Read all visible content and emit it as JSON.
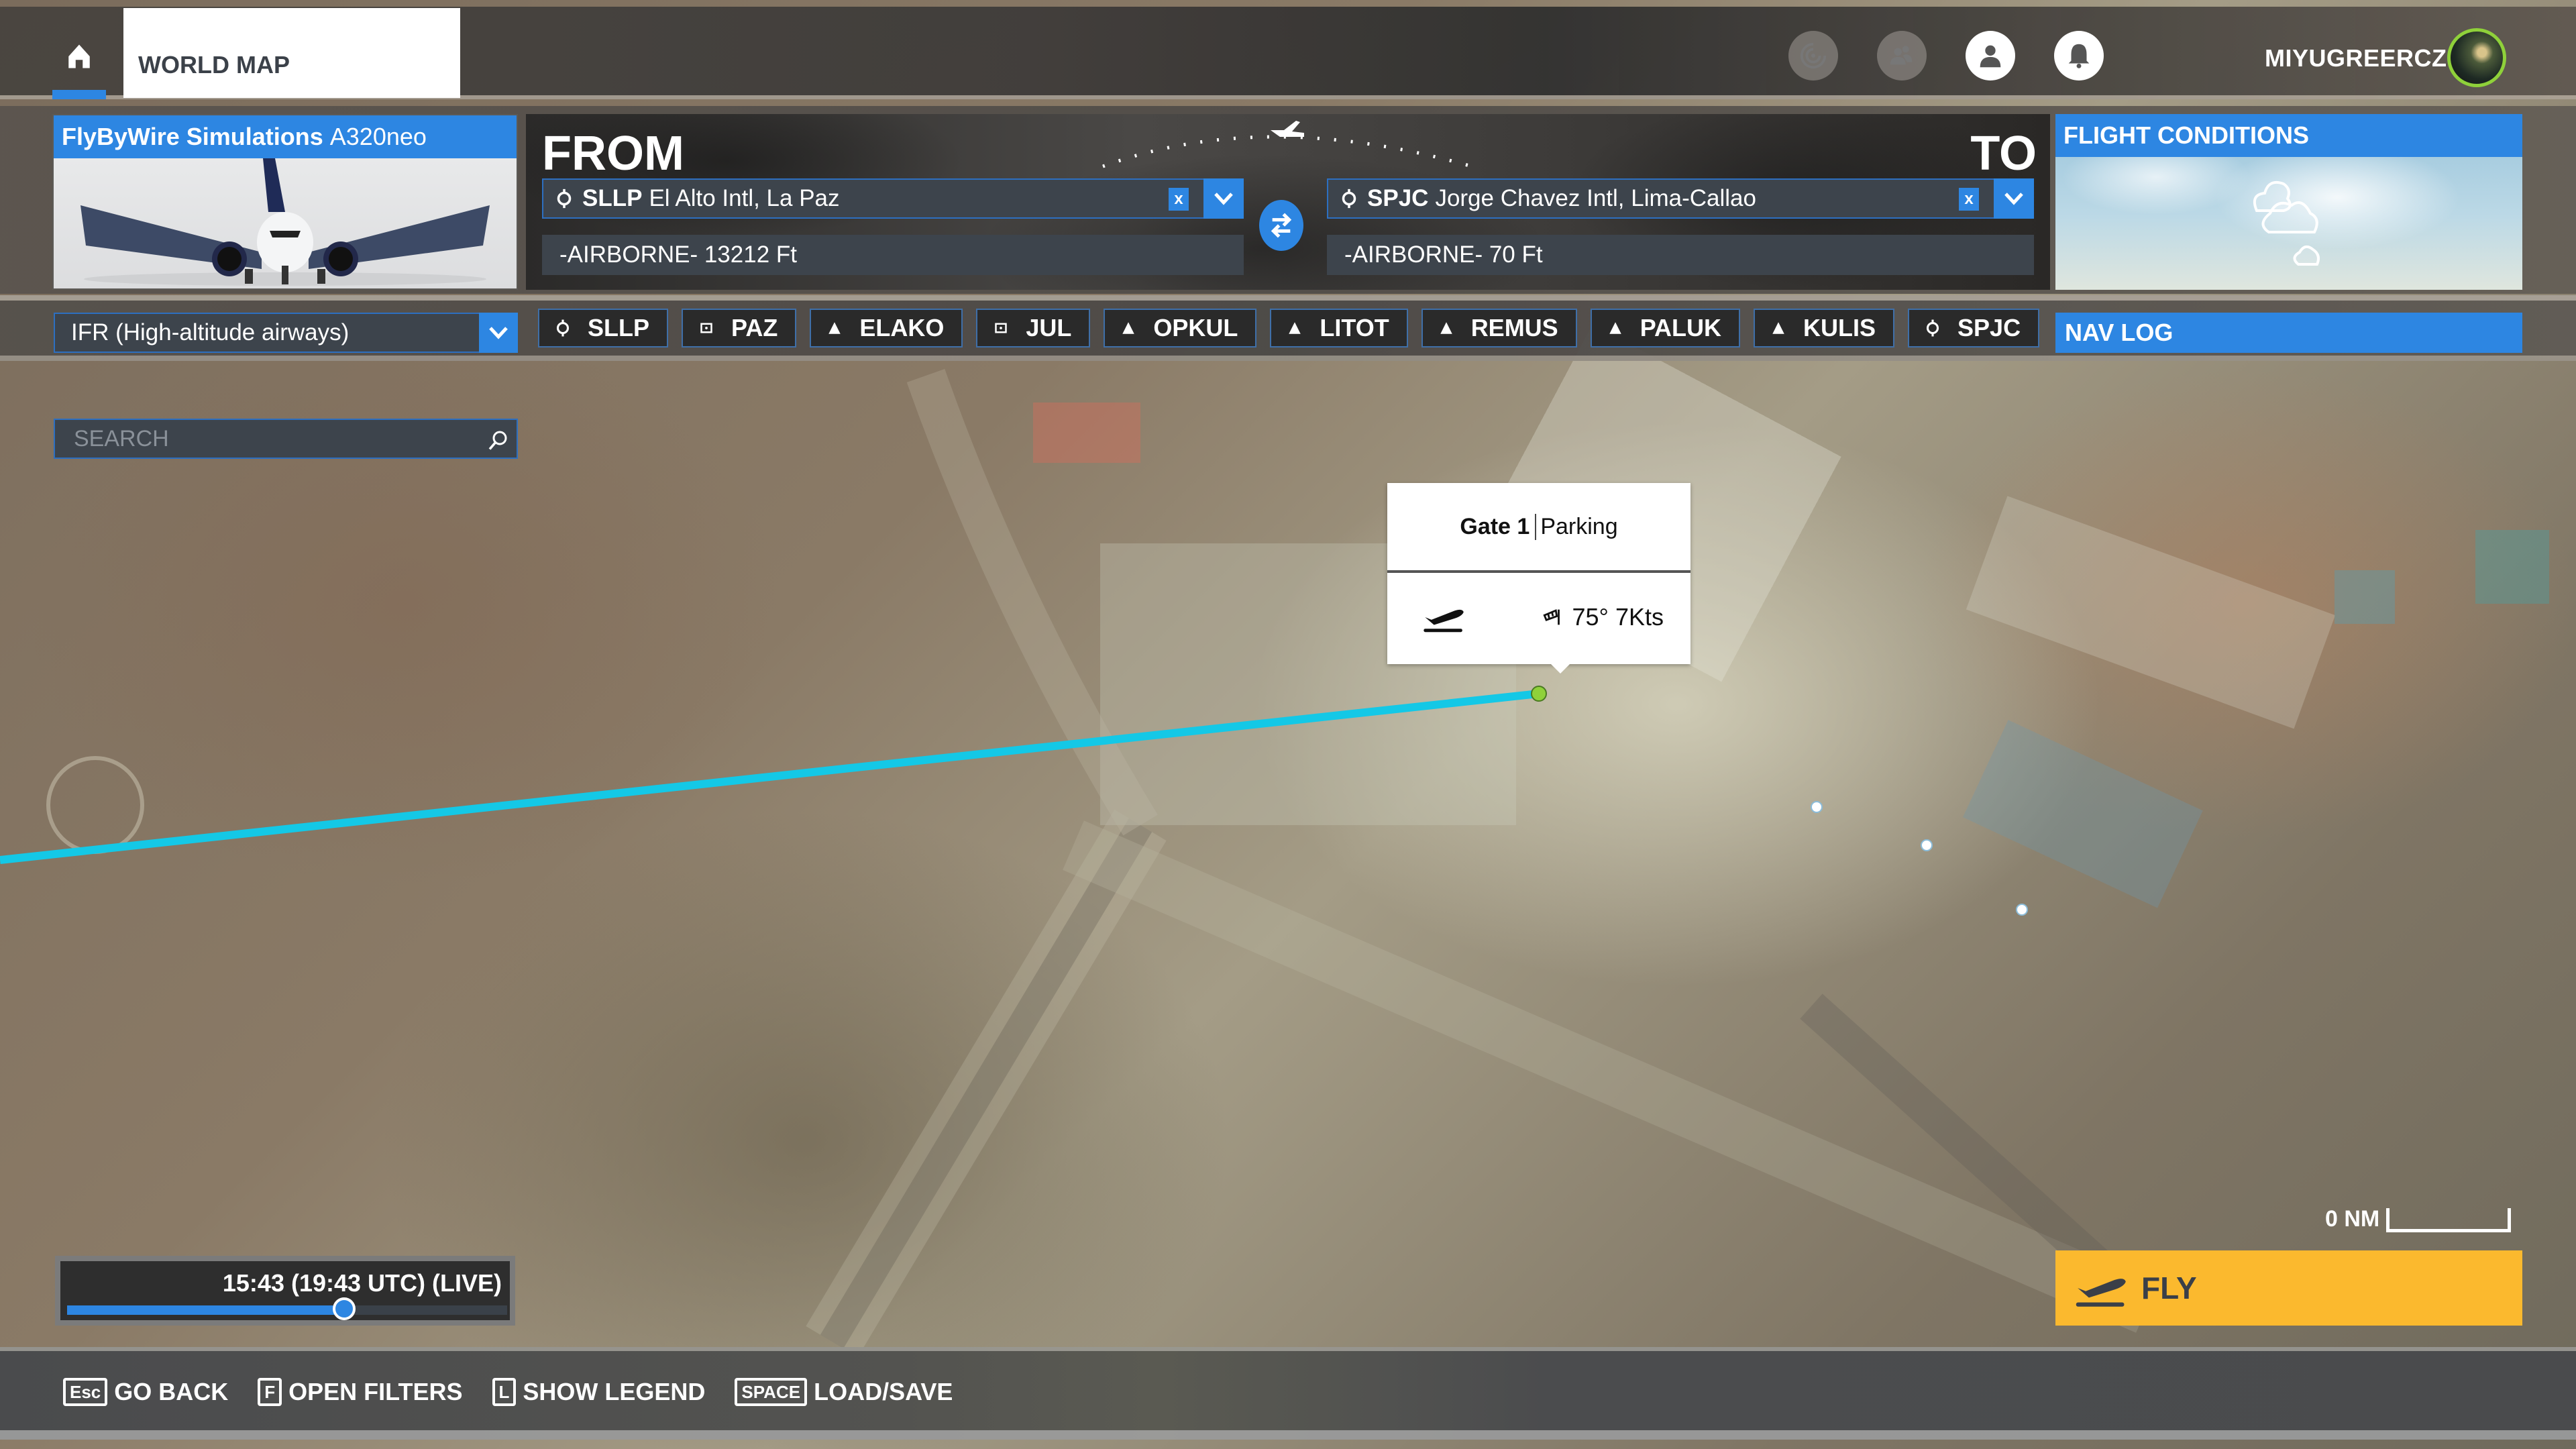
{
  "topbar": {
    "active_tab": "WORLD MAP",
    "username": "MIYUGREERCZ",
    "icons": [
      "activity-feed-icon",
      "friends-icon",
      "profile-icon",
      "notifications-bell-icon"
    ]
  },
  "aircraft": {
    "brand": "FlyByWire Simulations",
    "model": "A320neo"
  },
  "route": {
    "from_label": "FROM",
    "to_label": "TO",
    "departure": {
      "icao": "SLLP",
      "name": "El Alto Intl, La Paz",
      "status": "-AIRBORNE- 13212 Ft",
      "clear_label": "x"
    },
    "arrival": {
      "icao": "SPJC",
      "name": "Jorge Chavez Intl, Lima-Callao",
      "status": "-AIRBORNE- 70 Ft",
      "clear_label": "x"
    }
  },
  "conditions": {
    "title": "FLIGHT CONDITIONS",
    "weather_icon": "partly-cloudy-icon"
  },
  "flight_plan": {
    "type": "IFR (High-altitude airways)",
    "waypoints": [
      {
        "id": "SLLP",
        "kind": "airport"
      },
      {
        "id": "PAZ",
        "kind": "vor"
      },
      {
        "id": "ELAKO",
        "kind": "intersection"
      },
      {
        "id": "JUL",
        "kind": "vor"
      },
      {
        "id": "OPKUL",
        "kind": "intersection"
      },
      {
        "id": "LITOT",
        "kind": "intersection"
      },
      {
        "id": "REMUS",
        "kind": "intersection"
      },
      {
        "id": "PALUK",
        "kind": "intersection"
      },
      {
        "id": "KULIS",
        "kind": "intersection"
      },
      {
        "id": "SPJC",
        "kind": "airport"
      }
    ]
  },
  "navlog": {
    "label": "NAV LOG"
  },
  "search": {
    "placeholder": "SEARCH"
  },
  "gate_popup": {
    "gate": "Gate 1",
    "type": "Parking",
    "wind": "75° 7Kts"
  },
  "time": {
    "text": "15:43 (19:43 UTC) (LIVE)",
    "progress": 0.63
  },
  "map": {
    "scale_label": "0 NM",
    "route_color": "#14c8e6",
    "start_point_color": "#8fd13a"
  },
  "fly": {
    "label": "FLY"
  },
  "hints": [
    {
      "key": "Esc",
      "label": "GO BACK"
    },
    {
      "key": "F",
      "label": "OPEN FILTERS"
    },
    {
      "key": "L",
      "label": "SHOW LEGEND"
    },
    {
      "key": "SPACE",
      "label": "LOAD/SAVE"
    }
  ],
  "colors": {
    "accent": "#2d86e2",
    "fly_button": "#fbb92e",
    "field_bg": "#3d444c"
  }
}
